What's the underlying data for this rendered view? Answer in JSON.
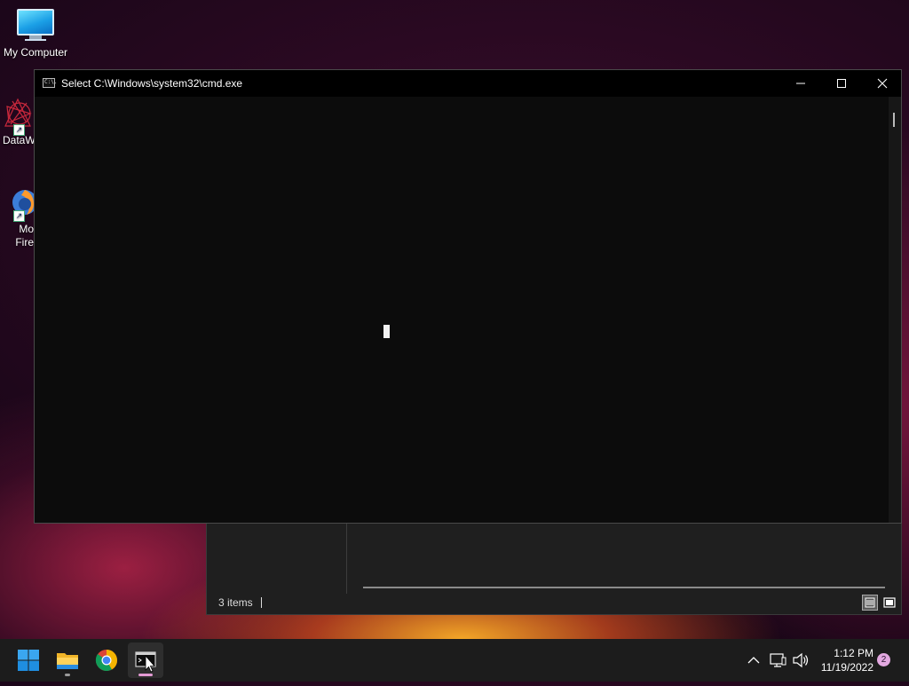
{
  "desktop": {
    "icons": [
      {
        "label": "My Computer"
      },
      {
        "label": "DataW"
      },
      {
        "label_line1": "Mo",
        "label_line2": "Fire"
      }
    ]
  },
  "explorer_window": {
    "status_count": "3 items"
  },
  "cmd_window": {
    "title": "Select C:\\Windows\\system32\\cmd.exe",
    "icon_text": "C:\\."
  },
  "taskbar": {
    "apps": [
      "start-icon",
      "file-explorer-icon",
      "chrome-icon",
      "cmd-icon"
    ],
    "clock_time": "1:12 PM",
    "clock_date": "11/19/2022",
    "notification_count": "2"
  },
  "colors": {
    "accent_indicator": "#e39ad4",
    "console_bg": "#0c0c0c",
    "taskbar_bg": "#1c1c1c"
  }
}
